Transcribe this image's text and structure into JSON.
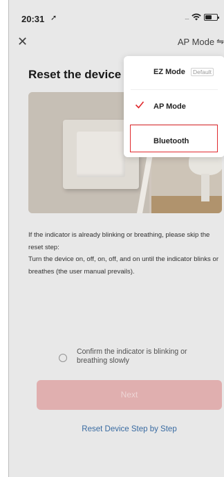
{
  "status_bar": {
    "time": "20:31",
    "location_icon": "location-arrow-icon",
    "signal_text": "....",
    "wifi_icon": "wifi-icon",
    "battery_icon": "battery-icon"
  },
  "header": {
    "close_icon": "close-icon",
    "mode_label": "AP Mode",
    "mode_icon": "switch-arrows-icon"
  },
  "page": {
    "title": "Reset the device",
    "illustration": "wall-switch-and-lamp-photo",
    "instructions": [
      "If the indicator is already blinking or breathing, please skip the reset step:",
      "Turn the device on, off, on, off, and on until the indicator blinks or breathes (the user manual prevails)."
    ],
    "confirm_text": "Confirm the indicator is blinking or breathing slowly",
    "next_label": "Next",
    "step_link": "Reset Device Step by Step"
  },
  "dropdown": {
    "items": [
      {
        "label": "EZ Mode",
        "badge": "Default"
      },
      {
        "label": "AP Mode",
        "selected": true
      },
      {
        "label": "Bluetooth",
        "highlighted": true
      }
    ],
    "check_color": "#e0282c",
    "highlight_color": "#e0282c"
  },
  "colors": {
    "next_button": "#eab7b7",
    "link": "#3b6fa8",
    "background": "#f2f2f2"
  }
}
